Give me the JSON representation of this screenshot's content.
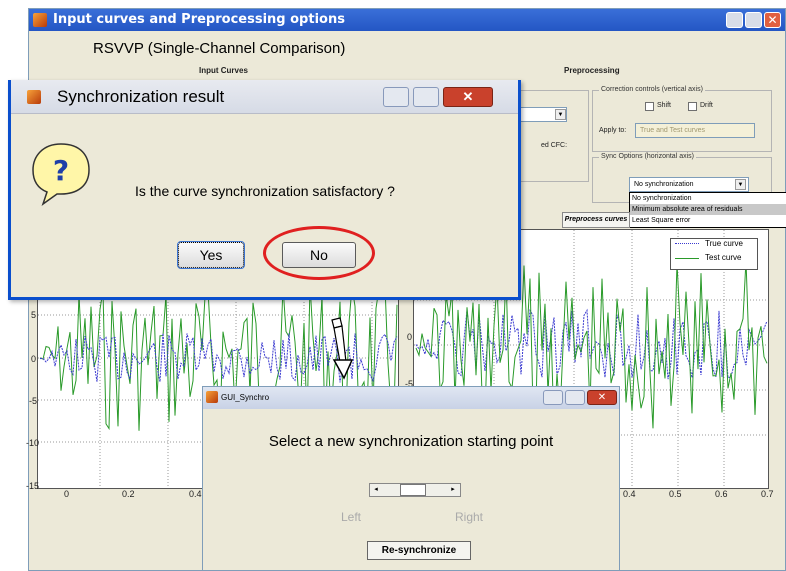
{
  "main_window": {
    "title": "Input curves and Preprocessing options",
    "subtitle": "RSVVP (Single-Channel Comparison)",
    "input_curves_label": "Input Curves",
    "preprocessing_label": "Preprocessing",
    "correction_controls_label": "Correction controls (vertical axis)",
    "shift_label": "Shift",
    "drift_label": "Drift",
    "apply_to_label": "Apply to:",
    "apply_to_value": "True and Test curves",
    "sync_options_label": "Sync Options (horizontal axis)",
    "sync_selected": "No synchronization",
    "sync_options": [
      "No synchronization",
      "Minimum absolute area of residuals",
      "Least Square error"
    ],
    "cfc_label": "ed CFC:",
    "preprocess_button": "Preprocess curves"
  },
  "plot_left": {
    "y_ticks": [
      "5",
      "0",
      "-5",
      "-10",
      "-15"
    ],
    "x_ticks": [
      "0",
      "0.2",
      "0.4"
    ]
  },
  "plot_right": {
    "y_ticks": [
      "0",
      "-5"
    ],
    "x_ticks": [
      "0.4",
      "0.5",
      "0.6",
      "0.7"
    ],
    "legend": [
      "True curve",
      "Test curve"
    ]
  },
  "dialog": {
    "title": "Synchronization result",
    "question": "Is the curve synchronization satisfactory ?",
    "yes_label": "Yes",
    "no_label": "No"
  },
  "sync_window": {
    "title": "GUI_Synchro",
    "heading": "Select a new synchronization starting point",
    "left_label": "Left",
    "right_label": "Right",
    "resync_button": "Re-synchronize"
  },
  "colors": {
    "true_curve": "#3a3ad0",
    "test_curve": "#2a9a2a",
    "highlight_circle": "#e02020"
  }
}
